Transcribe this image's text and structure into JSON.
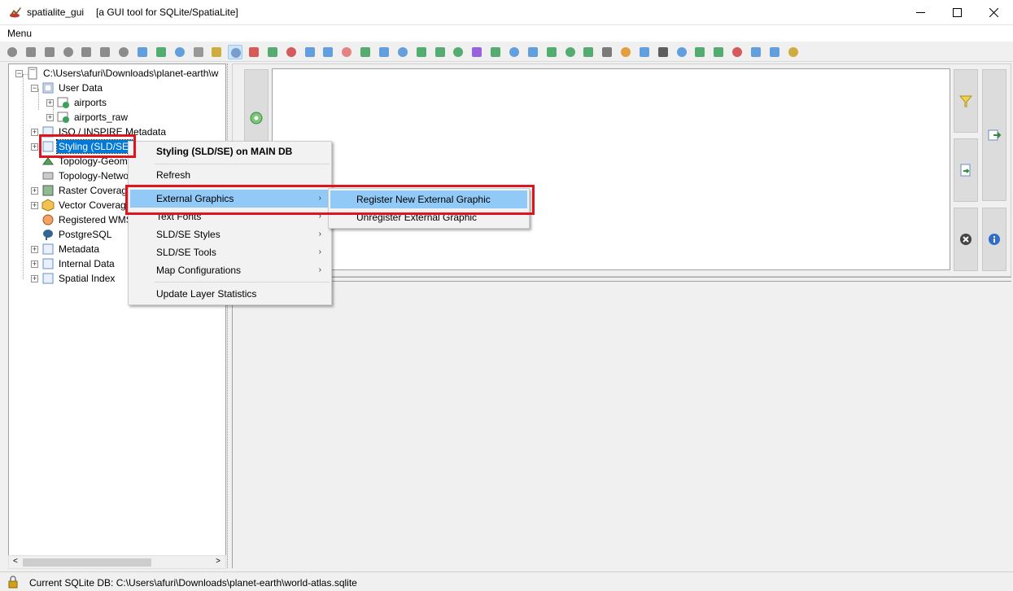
{
  "window": {
    "app_name": "spatialite_gui",
    "subtitle": "[a GUI tool for SQLite/SpatiaLite]",
    "minimize": "minimize",
    "maximize": "maximize",
    "close": "close"
  },
  "menubar": {
    "menu_label": "Menu"
  },
  "tree": {
    "root": "C:\\Users\\afuri\\Downloads\\planet-earth\\w",
    "items": [
      {
        "label": "User Data"
      },
      {
        "label": "airports"
      },
      {
        "label": "airports_raw"
      },
      {
        "label": "ISO / INSPIRE Metadata"
      },
      {
        "label": "Styling (SLD/SE)"
      },
      {
        "label": "Topology-Geometries"
      },
      {
        "label": "Topology-Network"
      },
      {
        "label": "Raster Coverages"
      },
      {
        "label": "Vector Coverages"
      },
      {
        "label": "Registered WMS"
      },
      {
        "label": "PostgreSQL"
      },
      {
        "label": "Metadata"
      },
      {
        "label": "Internal Data"
      },
      {
        "label": "Spatial Index"
      }
    ]
  },
  "context_menu": {
    "header": "Styling (SLD/SE) on MAIN DB",
    "items": [
      {
        "label": "Refresh"
      },
      {
        "label": "External Graphics"
      },
      {
        "label": "Text Fonts"
      },
      {
        "label": "SLD/SE Styles"
      },
      {
        "label": "SLD/SE Tools"
      },
      {
        "label": "Map Configurations"
      },
      {
        "label": "Update Layer Statistics"
      }
    ]
  },
  "submenu": {
    "items": [
      {
        "label": "Register New External Graphic"
      },
      {
        "label": "Unregister External Graphic"
      }
    ]
  },
  "status": {
    "text": "Current SQLite DB: C:\\Users\\afuri\\Downloads\\planet-earth\\world-atlas.sqlite"
  },
  "colors": {
    "selection": "#0078d7",
    "menu_highlight": "#91c9f7",
    "annotation_red": "#e0141c"
  }
}
